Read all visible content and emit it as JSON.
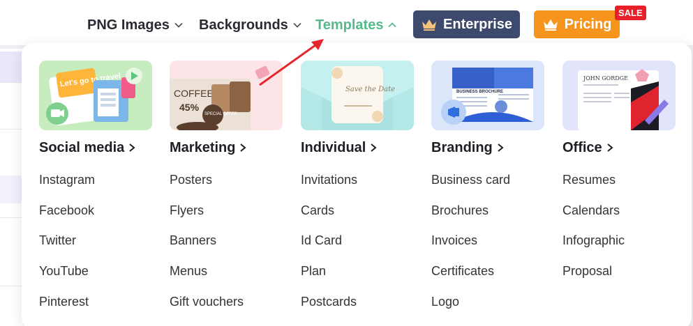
{
  "nav": {
    "png_images": "PNG Images",
    "backgrounds": "Backgrounds",
    "templates": "Templates",
    "enterprise": "Enterprise",
    "pricing": "Pricing",
    "sale_badge": "SALE"
  },
  "colors": {
    "templates_active": "#55b98a",
    "enterprise_bg": "#3e4a6d",
    "pricing_bg": "#f7941d",
    "sale_bg": "#e8202a",
    "arrow": "#e4262c"
  },
  "columns": [
    {
      "title": "Social media",
      "thumb_text": "Let's go to travel",
      "items": [
        "Instagram",
        "Facebook",
        "Twitter",
        "YouTube",
        "Pinterest"
      ]
    },
    {
      "title": "Marketing",
      "thumb_text": "COFFEE",
      "thumb_subtext": "45%",
      "thumb_badge": "SPECIAL OFFER",
      "items": [
        "Posters",
        "Flyers",
        "Banners",
        "Menus",
        "Gift vouchers"
      ]
    },
    {
      "title": "Individual",
      "thumb_text": "Save the Date",
      "items": [
        "Invitations",
        "Cards",
        "Id Card",
        "Plan",
        "Postcards"
      ]
    },
    {
      "title": "Branding",
      "thumb_text": "BUSINESS BROCHURE",
      "items": [
        "Business card",
        "Brochures",
        "Invoices",
        "Certificates",
        "Logo"
      ]
    },
    {
      "title": "Office",
      "thumb_text": "JOHN GORDGE",
      "items": [
        "Resumes",
        "Calendars",
        "Infographic",
        "Proposal"
      ]
    }
  ]
}
